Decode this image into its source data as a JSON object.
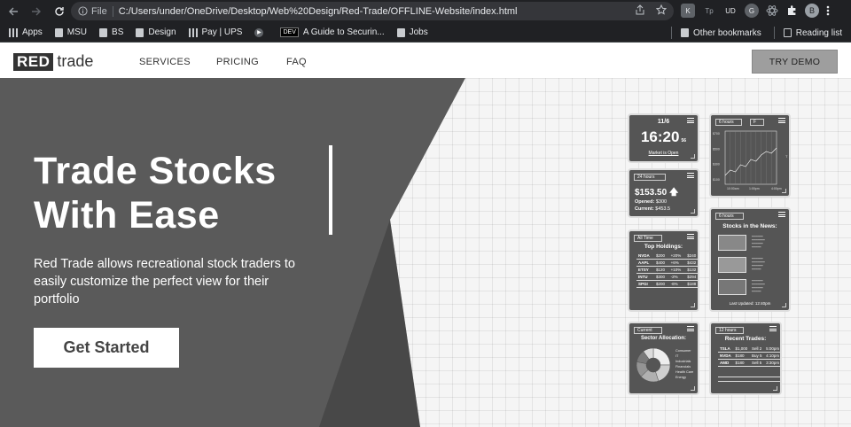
{
  "browser": {
    "url_scheme": "File",
    "url": "C:/Users/under/OneDrive/Desktop/Web%20Design/Red-Trade/OFFLINE-Website/index.html",
    "bookmarks": [
      "Apps",
      "MSU",
      "BS",
      "Design",
      "Pay | UPS",
      "",
      "A Guide to Securin...",
      "Jobs"
    ],
    "bookmark_dev_badge": "DEV",
    "other_bookmarks": "Other bookmarks",
    "reading_list": "Reading list",
    "profile_initial": "B",
    "extensions": [
      "K",
      "Tp",
      "UD",
      "G"
    ]
  },
  "site": {
    "logo_red": "RED",
    "logo_trade": "trade",
    "nav": [
      "SERVICES",
      "PRICING",
      "FAQ"
    ],
    "try_demo": "TRY DEMO"
  },
  "hero": {
    "headline_line1": "Trade Stocks",
    "headline_line2": "With Ease",
    "subtext": "Red Trade allows recreational stock traders to easily customize the perfect view for their portfolio",
    "cta": "Get Started"
  },
  "widgets": {
    "clock": {
      "date": "11/6",
      "time": "16:20",
      "seconds": "56",
      "status": "Market is Open"
    },
    "price": {
      "range": "24 hours",
      "value": "$153.50",
      "opened_label": "Opened:",
      "opened": "$300",
      "current_label": "Current:",
      "current": "$453.5"
    },
    "chart": {
      "range": "6 hours",
      "symbol": "F",
      "y_ticks": [
        "$700",
        "$500",
        "$300",
        "$100"
      ],
      "x_ticks": [
        "10:00am",
        "1:00pm",
        "4:00pm"
      ],
      "side_label": "T",
      "values": [
        200,
        260,
        240,
        320,
        300,
        380,
        360,
        430,
        470,
        450,
        510
      ]
    },
    "holdings": {
      "range": "All Time",
      "title": "Top Holdings:",
      "rows": [
        [
          "NVDA",
          "$200",
          "+20%",
          "$240"
        ],
        [
          "AAPL",
          "$400",
          "+6%",
          "$432"
        ],
        [
          "ETSY",
          "$120",
          "+10%",
          "$132"
        ],
        [
          "INTU",
          "$300",
          "-2%",
          "$294"
        ],
        [
          "SPGI",
          "$200",
          "-6%",
          "$188"
        ]
      ]
    },
    "news": {
      "range": "6 hours",
      "title": "Stocks in the News:",
      "updated": "Last Updated: 12:40pm"
    },
    "sectors": {
      "range": "Current",
      "title": "Sector Allocation:",
      "legend": [
        "Consumer",
        "IT",
        "Industrials",
        "Financials",
        "Health Care",
        "Energy"
      ],
      "shares": [
        25,
        20,
        18,
        15,
        12,
        10
      ]
    },
    "trades": {
      "range": "12 hours",
      "title": "Recent Trades:",
      "rows": [
        [
          "TSLA",
          "$1,000",
          "Sell 2",
          "5:00pm"
        ],
        [
          "NVDA",
          "$180",
          "Buy 5",
          "4:10pm"
        ],
        [
          "AMD",
          "$180",
          "Sell 5",
          "3:30pm"
        ]
      ]
    }
  }
}
